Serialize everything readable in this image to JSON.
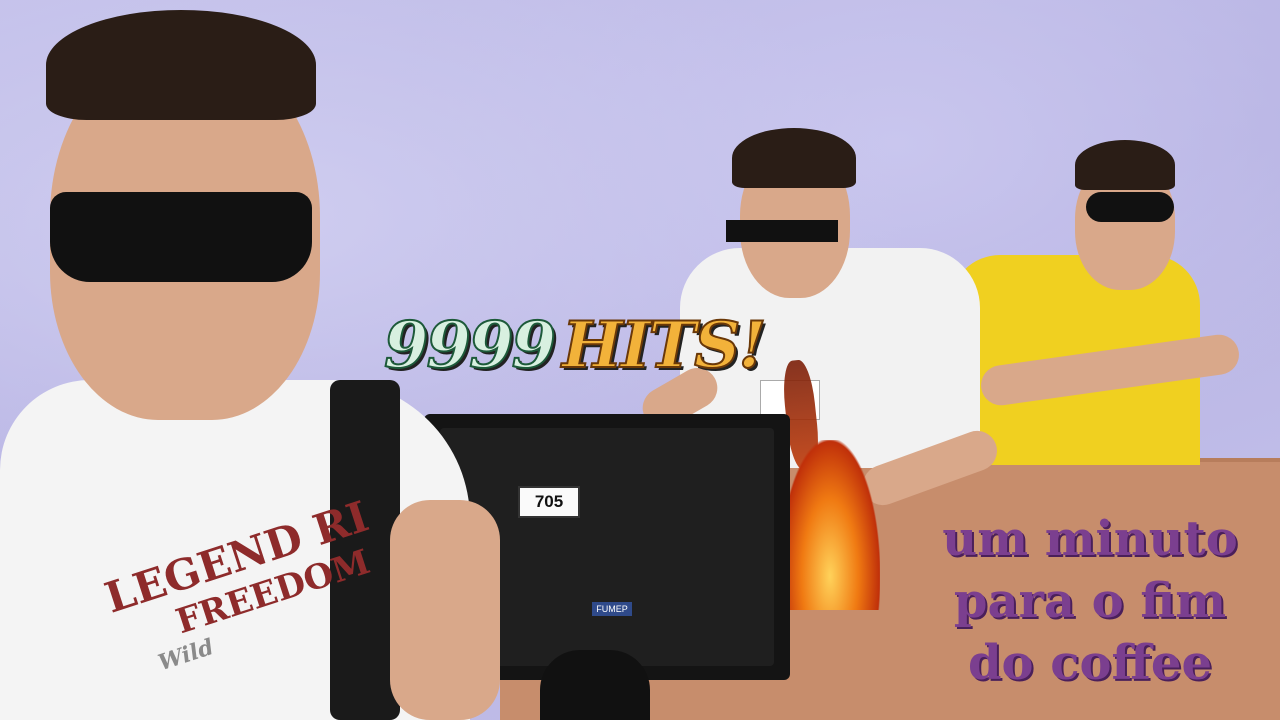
{
  "scene": {
    "title_overlay": {
      "number": "9999",
      "word": "HITS!"
    },
    "caption": [
      "um minuto",
      "para o fim",
      "do coffee"
    ],
    "monitor_label": "705",
    "monitor_brand": "FUMEP",
    "shirt_text": [
      "LEGEND RI",
      "FREEDOM",
      "Wild"
    ]
  },
  "colors": {
    "background": "#c3c0ea",
    "table": "#c78d6c",
    "caption": "#7b3f8f",
    "hits_gold": "#f2b23a"
  }
}
